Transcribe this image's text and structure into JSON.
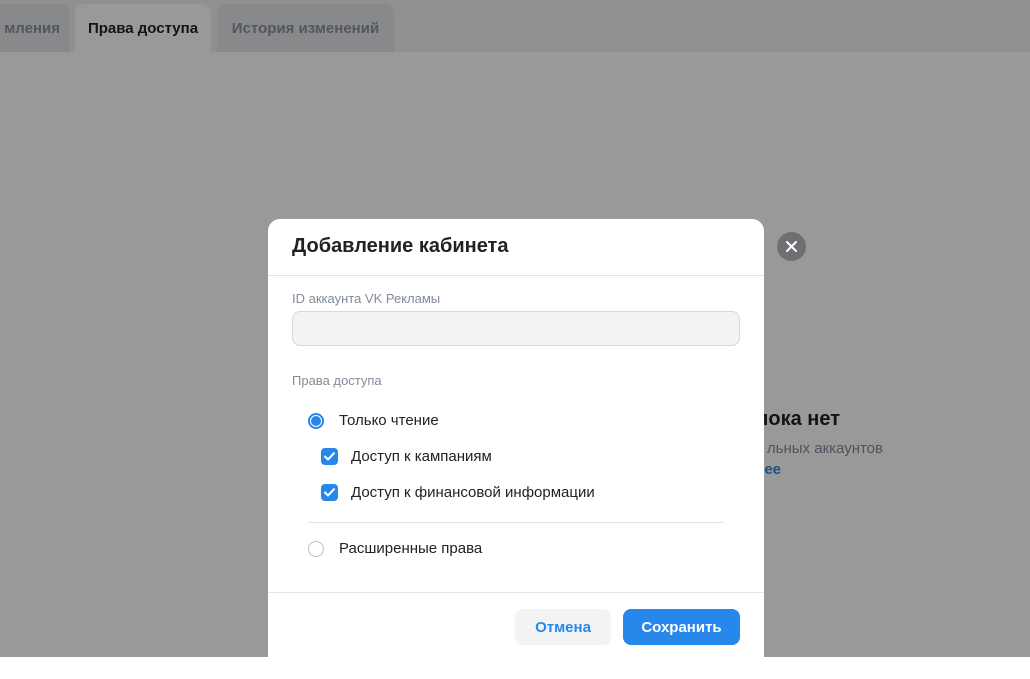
{
  "tabs": [
    {
      "label": "мления"
    },
    {
      "label": "Права доступа",
      "active": true
    },
    {
      "label": "История изменений"
    }
  ],
  "background": {
    "empty_title": "пока нет",
    "empty_text": "льных аккаунтов",
    "empty_link": "ее"
  },
  "modal": {
    "title": "Добавление кабинета",
    "account_field": {
      "label": "ID аккаунта VK Рекламы",
      "value": "",
      "placeholder": ""
    },
    "access_section_label": "Права доступа",
    "options": {
      "read_only": {
        "label": "Только чтение",
        "selected": true
      },
      "campaign_access": {
        "label": "Доступ к кампаниям",
        "checked": true
      },
      "finance_access": {
        "label": "Доступ к финансовой информации",
        "checked": true
      },
      "extended": {
        "label": "Расширенные права",
        "selected": false
      }
    },
    "cancel_label": "Отмена",
    "save_label": "Сохранить",
    "close_icon": "close-icon"
  },
  "colors": {
    "accent": "#2688eb",
    "overlay": "rgba(0,0,0,0.4)",
    "close_button_bg": "#6d6f73"
  }
}
